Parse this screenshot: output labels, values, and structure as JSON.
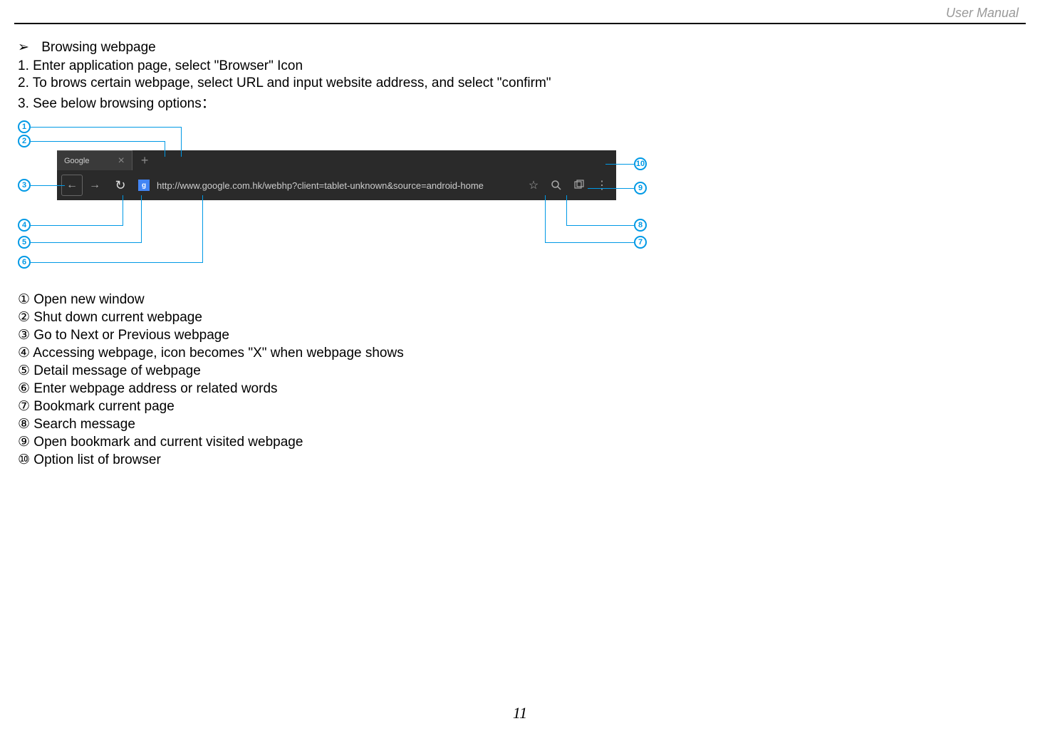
{
  "header": {
    "title": "User Manual"
  },
  "section": {
    "title": "Browsing webpage",
    "steps": [
      "1. Enter application page, select \"Browser\" Icon",
      "2. To brows certain webpage, select URL and input website address, and select \"confirm\"",
      "3. See below browsing options："
    ]
  },
  "browser": {
    "tab_title": "Google",
    "url": "http://www.google.com.hk/webhp?client=tablet-unknown&source=android-home"
  },
  "callouts": {
    "c1": "1",
    "c2": "2",
    "c3": "3",
    "c4": "4",
    "c5": "5",
    "c6": "6",
    "c7": "7",
    "c8": "8",
    "c9": "9",
    "c10": "10"
  },
  "legend": {
    "items": [
      "① Open new window",
      "② Shut down current webpage",
      "③ Go to Next or Previous webpage",
      "④ Accessing webpage, icon becomes \"X\" when webpage shows",
      "⑤ Detail message of webpage",
      "⑥ Enter webpage address or related words",
      "⑦ Bookmark current page",
      "⑧ Search message",
      "⑨ Open bookmark and current visited webpage",
      "⑩ Option list of browser"
    ]
  },
  "page_number": "11"
}
